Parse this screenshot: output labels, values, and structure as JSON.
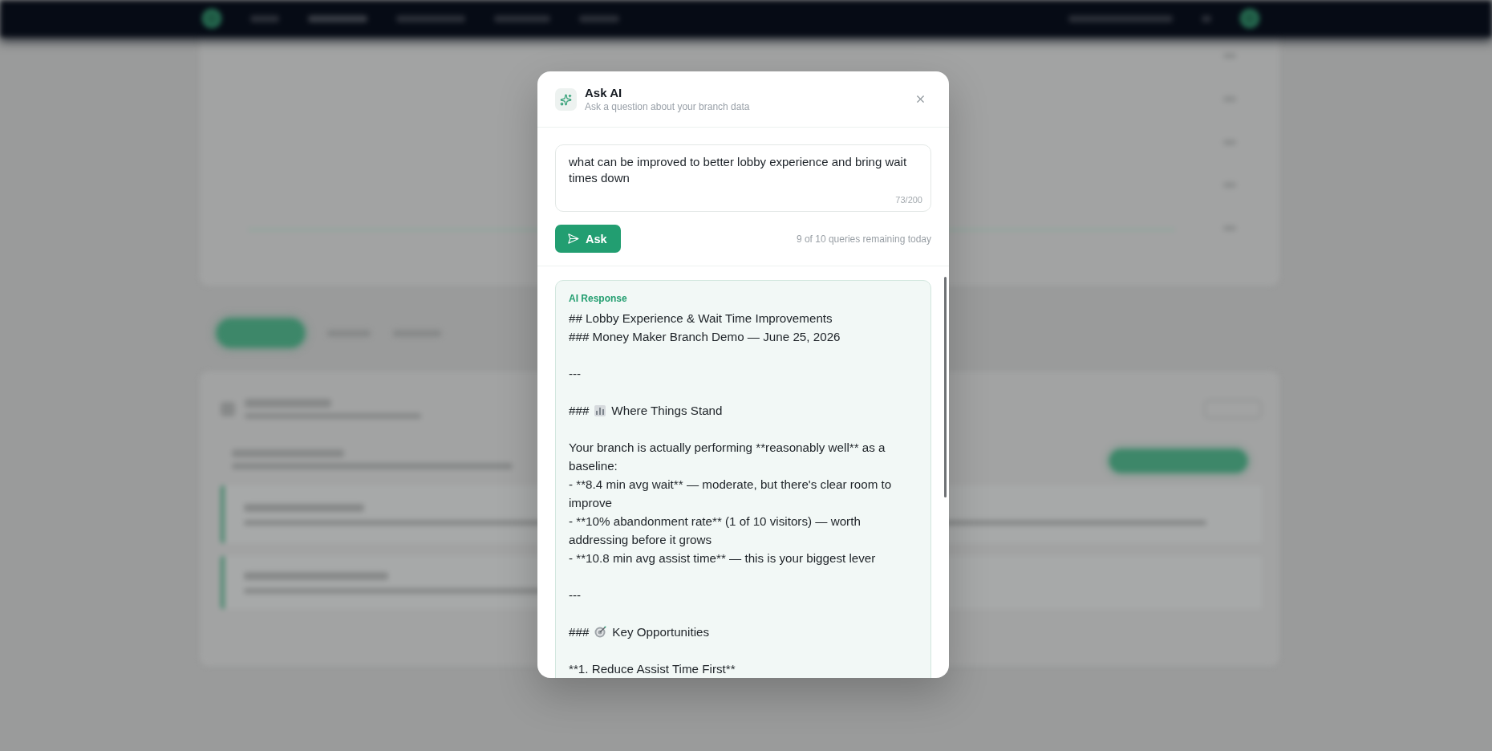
{
  "dialog": {
    "title": "Ask AI",
    "subtitle": "Ask a question about your branch data"
  },
  "question": {
    "value": "what can be improved to better lobby experience and bring wait times down",
    "counter": "73/200"
  },
  "ask_button": {
    "label": "Ask"
  },
  "quota": "9 of 10 queries remaining today",
  "response": {
    "label": "AI Response",
    "blocks": [
      {
        "lines": [
          {
            "kind": "text",
            "text": "## Lobby Experience & Wait Time Improvements"
          },
          {
            "kind": "text",
            "text": "### Money Maker Branch Demo — June 25, 2026"
          }
        ]
      },
      {
        "lines": [
          {
            "kind": "text",
            "text": "---"
          }
        ]
      },
      {
        "lines": [
          {
            "kind": "icon_heading",
            "marker": "###",
            "text": "Where Things Stand"
          }
        ]
      },
      {
        "lines": [
          {
            "kind": "text",
            "text": "Your branch is actually performing **reasonably well** as a baseline:"
          },
          {
            "kind": "text",
            "text": "- **8.4 min avg wait** — moderate, but there's clear room to improve"
          },
          {
            "kind": "text",
            "text": "- **10% abandonment rate** (1 of 10 visitors) — worth addressing before it grows"
          },
          {
            "kind": "text",
            "text": "- **10.8 min avg assist time** — this is your biggest lever"
          }
        ]
      },
      {
        "lines": [
          {
            "kind": "text",
            "text": "---"
          }
        ]
      },
      {
        "lines": [
          {
            "kind": "icon_heading",
            "marker": "###",
            "text": "Key Opportunities"
          }
        ]
      },
      {
        "lines": [
          {
            "kind": "text",
            "text": "**1. Reduce Assist Time First**"
          }
        ]
      }
    ]
  }
}
